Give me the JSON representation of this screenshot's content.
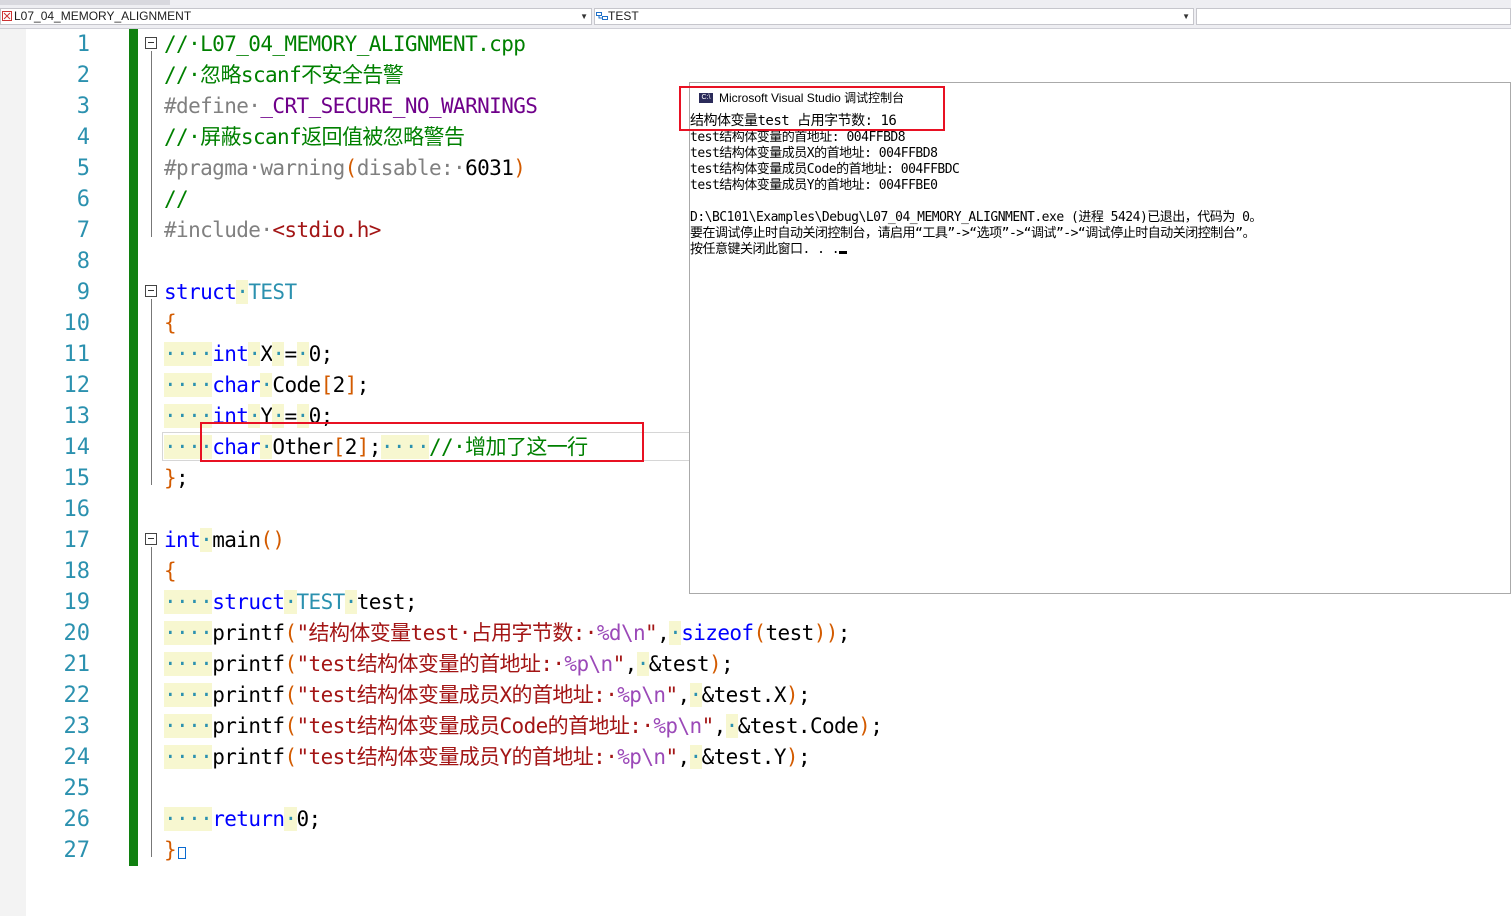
{
  "navbar": {
    "project_combo": "L07_04_MEMORY_ALIGNMENT",
    "scope_combo": "TEST",
    "member_combo": ""
  },
  "editor": {
    "lines": [
      [
        [
          "cm",
          "//·L07_04_MEMORY_ALIGNMENT.cpp"
        ]
      ],
      [
        [
          "cm",
          "//·忽略scanf不安全告警"
        ]
      ],
      [
        [
          "pp",
          "#define·"
        ],
        [
          "mc",
          "_CRT_SECURE_NO_WARNINGS"
        ]
      ],
      [
        [
          "cm",
          "//·屏蔽scanf返回值被忽略警告"
        ]
      ],
      [
        [
          "pp",
          "#pragma·warning"
        ],
        [
          "br",
          "("
        ],
        [
          "pp",
          "disable:·"
        ],
        [
          "nm",
          "6031"
        ],
        [
          "br",
          ")"
        ]
      ],
      [
        [
          "cm",
          "//"
        ]
      ],
      [
        [
          "pp",
          "#include·"
        ],
        [
          "st",
          "<stdio.h>"
        ]
      ],
      [],
      [
        [
          "kw",
          "struct"
        ],
        [
          "ws",
          "·"
        ],
        [
          "ty",
          "TEST"
        ]
      ],
      [
        [
          "br",
          "{"
        ]
      ],
      [
        [
          "ws",
          "····"
        ],
        [
          "kw",
          "int"
        ],
        [
          "ws",
          "·"
        ],
        [
          "nm",
          "X"
        ],
        [
          "ws",
          "·"
        ],
        [
          "nm",
          "="
        ],
        [
          "ws",
          "·"
        ],
        [
          "nm",
          "0;"
        ]
      ],
      [
        [
          "ws",
          "····"
        ],
        [
          "kw",
          "char"
        ],
        [
          "ws",
          "·"
        ],
        [
          "nm",
          "Code"
        ],
        [
          "br",
          "["
        ],
        [
          "nm",
          "2"
        ],
        [
          "br",
          "]"
        ],
        [
          "nm",
          ";"
        ]
      ],
      [
        [
          "ws",
          "····"
        ],
        [
          "kw",
          "int"
        ],
        [
          "ws",
          "·"
        ],
        [
          "nm",
          "Y"
        ],
        [
          "ws",
          "·"
        ],
        [
          "nm",
          "="
        ],
        [
          "ws",
          "·"
        ],
        [
          "nm",
          "0;"
        ]
      ],
      [
        [
          "ws",
          "····"
        ],
        [
          "kw",
          "char"
        ],
        [
          "ws",
          "·"
        ],
        [
          "nm",
          "Other"
        ],
        [
          "br",
          "["
        ],
        [
          "nm",
          "2"
        ],
        [
          "br",
          "]"
        ],
        [
          "nm",
          ";"
        ],
        [
          "ws",
          "····"
        ],
        [
          "cm",
          "//·增加了这一行"
        ]
      ],
      [
        [
          "br",
          "}"
        ],
        [
          "nm",
          ";"
        ]
      ],
      [],
      [
        [
          "kw",
          "int"
        ],
        [
          "ws",
          "·"
        ],
        [
          "nm",
          "main"
        ],
        [
          "br",
          "()"
        ]
      ],
      [
        [
          "br",
          "{"
        ]
      ],
      [
        [
          "ws",
          "····"
        ],
        [
          "kw",
          "struct"
        ],
        [
          "ws",
          "·"
        ],
        [
          "ty",
          "TEST"
        ],
        [
          "ws",
          "·"
        ],
        [
          "nm",
          "test;"
        ]
      ],
      [
        [
          "ws",
          "····"
        ],
        [
          "nm",
          "printf"
        ],
        [
          "br",
          "("
        ],
        [
          "st",
          "\"结构体变量test·占用字节数:·"
        ],
        [
          "fm",
          "%d\\n"
        ],
        [
          "st",
          "\""
        ],
        [
          "nm",
          ","
        ],
        [
          "ws",
          "·"
        ],
        [
          "kw",
          "sizeof"
        ],
        [
          "br",
          "("
        ],
        [
          "nm",
          "test"
        ],
        [
          "br",
          "))"
        ],
        [
          "nm",
          ";"
        ]
      ],
      [
        [
          "ws",
          "····"
        ],
        [
          "nm",
          "printf"
        ],
        [
          "br",
          "("
        ],
        [
          "st",
          "\"test结构体变量的首地址:·"
        ],
        [
          "fm",
          "%p\\n"
        ],
        [
          "st",
          "\""
        ],
        [
          "nm",
          ","
        ],
        [
          "ws",
          "·"
        ],
        [
          "nm",
          "&test"
        ],
        [
          "br",
          ")"
        ],
        [
          "nm",
          ";"
        ]
      ],
      [
        [
          "ws",
          "····"
        ],
        [
          "nm",
          "printf"
        ],
        [
          "br",
          "("
        ],
        [
          "st",
          "\"test结构体变量成员X的首地址:·"
        ],
        [
          "fm",
          "%p\\n"
        ],
        [
          "st",
          "\""
        ],
        [
          "nm",
          ","
        ],
        [
          "ws",
          "·"
        ],
        [
          "nm",
          "&test.X"
        ],
        [
          "br",
          ")"
        ],
        [
          "nm",
          ";"
        ]
      ],
      [
        [
          "ws",
          "····"
        ],
        [
          "nm",
          "printf"
        ],
        [
          "br",
          "("
        ],
        [
          "st",
          "\"test结构体变量成员Code的首地址:·"
        ],
        [
          "fm",
          "%p\\n"
        ],
        [
          "st",
          "\""
        ],
        [
          "nm",
          ","
        ],
        [
          "ws",
          "·"
        ],
        [
          "nm",
          "&test.Code"
        ],
        [
          "br",
          ")"
        ],
        [
          "nm",
          ";"
        ]
      ],
      [
        [
          "ws",
          "····"
        ],
        [
          "nm",
          "printf"
        ],
        [
          "br",
          "("
        ],
        [
          "st",
          "\"test结构体变量成员Y的首地址:·"
        ],
        [
          "fm",
          "%p\\n"
        ],
        [
          "st",
          "\""
        ],
        [
          "nm",
          ","
        ],
        [
          "ws",
          "·"
        ],
        [
          "nm",
          "&test.Y"
        ],
        [
          "br",
          ")"
        ],
        [
          "nm",
          ";"
        ]
      ],
      [],
      [
        [
          "ws",
          "····"
        ],
        [
          "kw",
          "return"
        ],
        [
          "ws",
          "·"
        ],
        [
          "nm",
          "0;"
        ]
      ],
      [
        [
          "br",
          "}"
        ]
      ]
    ]
  },
  "console": {
    "icon_text": "C:\\",
    "title": "Microsoft Visual Studio 调试控制台",
    "output": [
      "结构体变量test 占用字节数: 16",
      "test结构体变量的首地址: 004FFBD8",
      "test结构体变量成员X的首地址: 004FFBD8",
      "test结构体变量成员Code的首地址: 004FFBDC",
      "test结构体变量成员Y的首地址: 004FFBE0",
      "",
      "D:\\BC101\\Examples\\Debug\\L07_04_MEMORY_ALIGNMENT.exe (进程 5424)已退出，代码为 0。",
      "要在调试停止时自动关闭控制台，请启用“工具”->“选项”->“调试”->“调试停止时自动关闭控制台”。",
      "按任意键关闭此窗口. . ."
    ]
  },
  "colors": {
    "change_bar": "#108010",
    "highlight_box": "#e81123",
    "line_number": "#2b91af"
  }
}
